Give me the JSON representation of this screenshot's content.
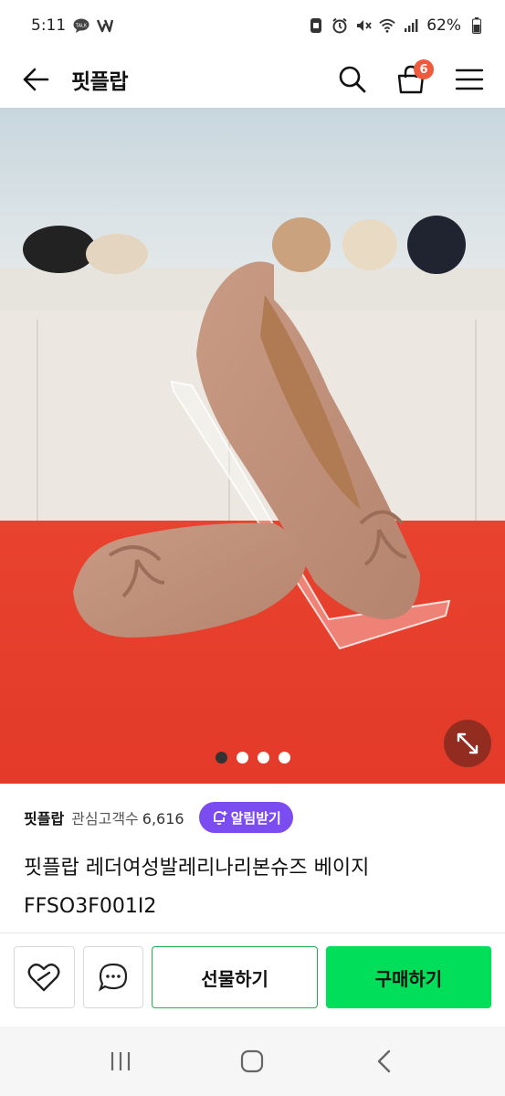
{
  "status_bar": {
    "time": "5:11",
    "battery": "62%",
    "left_icons": [
      "talk-icon",
      "v-icon"
    ],
    "right_icons": [
      "app-icon",
      "alarm-icon",
      "mute-icon",
      "wifi-icon",
      "signal-icon",
      "battery-icon"
    ]
  },
  "header": {
    "title": "핏플랍",
    "cart_count": "6"
  },
  "gallery": {
    "image_count": 4,
    "active_index": 0
  },
  "store": {
    "name": "핏플랍",
    "watchers_label": "관심고객수",
    "watchers_count": "6,616",
    "notify_label": "알림받기"
  },
  "product": {
    "name": "핏플랍 레더여성발레리나리본슈즈 베이지 FFSO3F001I2"
  },
  "bottom_bar": {
    "gift_label": "선물하기",
    "buy_label": "구매하기"
  },
  "colors": {
    "accent_purple": "#7b4cf0",
    "buy_green": "#00de5a",
    "badge_orange": "#f05a3c"
  }
}
